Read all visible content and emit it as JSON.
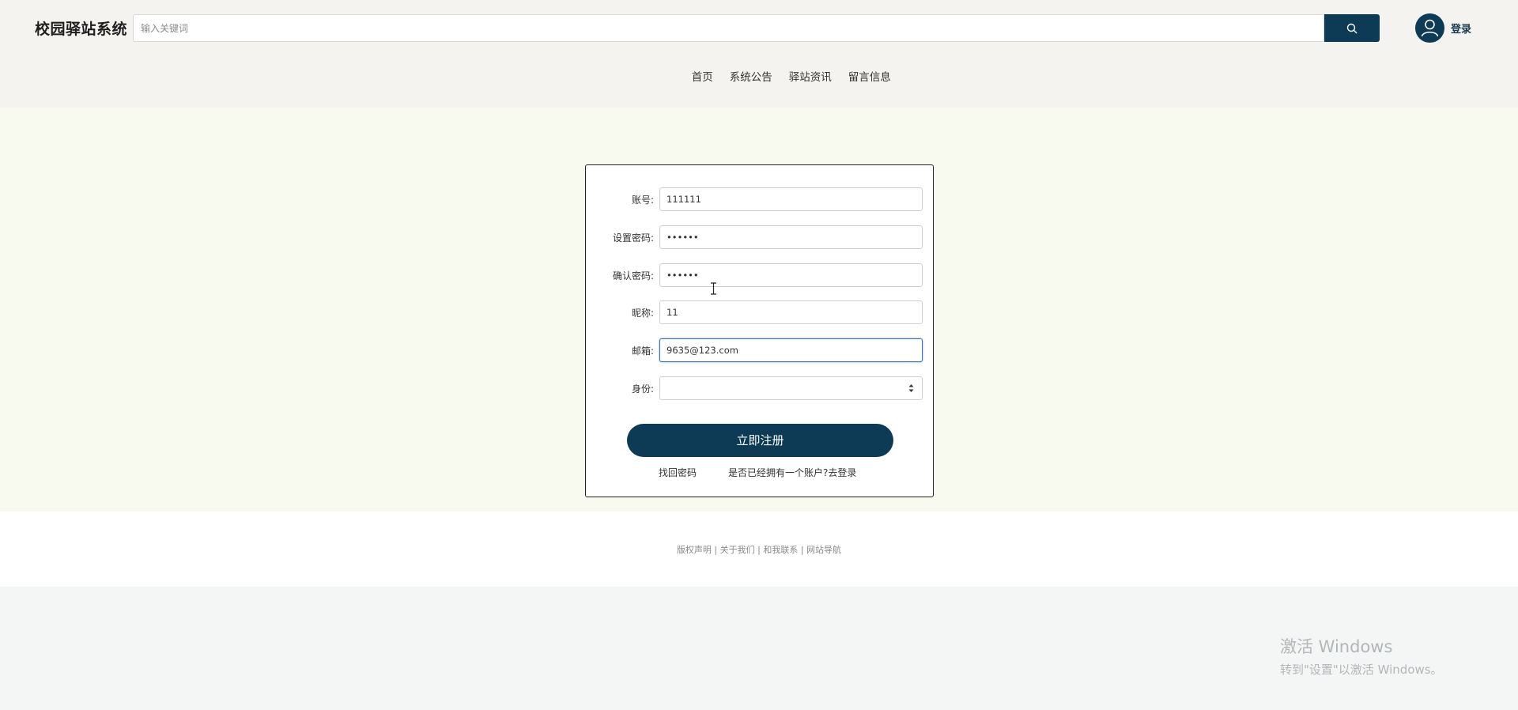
{
  "header": {
    "logo": "校园驿站系统",
    "search_placeholder": "输入关键词",
    "login_label": "登录"
  },
  "nav": {
    "items": [
      {
        "label": "首页"
      },
      {
        "label": "系统公告"
      },
      {
        "label": "驿站资讯"
      },
      {
        "label": "留言信息"
      }
    ]
  },
  "form": {
    "fields": [
      {
        "label": "账号:",
        "value": "111111"
      },
      {
        "label": "设置密码:",
        "value": "••••••"
      },
      {
        "label": "确认密码:",
        "value": "••••••"
      },
      {
        "label": "昵称:",
        "value": "11"
      },
      {
        "label": "邮箱:",
        "value": "9635@123.com"
      },
      {
        "label": "身份:",
        "value": ""
      }
    ],
    "submit_label": "立即注册",
    "forgot_label": "找回密码",
    "login_link_label": "是否已经拥有一个账户?去登录"
  },
  "footer": {
    "links": [
      "版权声明",
      "关于我们",
      "和我联系",
      "网站导航"
    ],
    "separator": " | "
  },
  "watermark": {
    "title": "激活 Windows",
    "subtitle": "转到\"设置\"以激活 Windows。"
  },
  "colors": {
    "accent": "#0d3a55",
    "header_bg": "#f4f3ef",
    "main_bg": "#f8f9ef"
  },
  "icons": [
    "search-icon",
    "user-avatar-icon",
    "select-arrow-icon",
    "text-cursor-icon"
  ]
}
